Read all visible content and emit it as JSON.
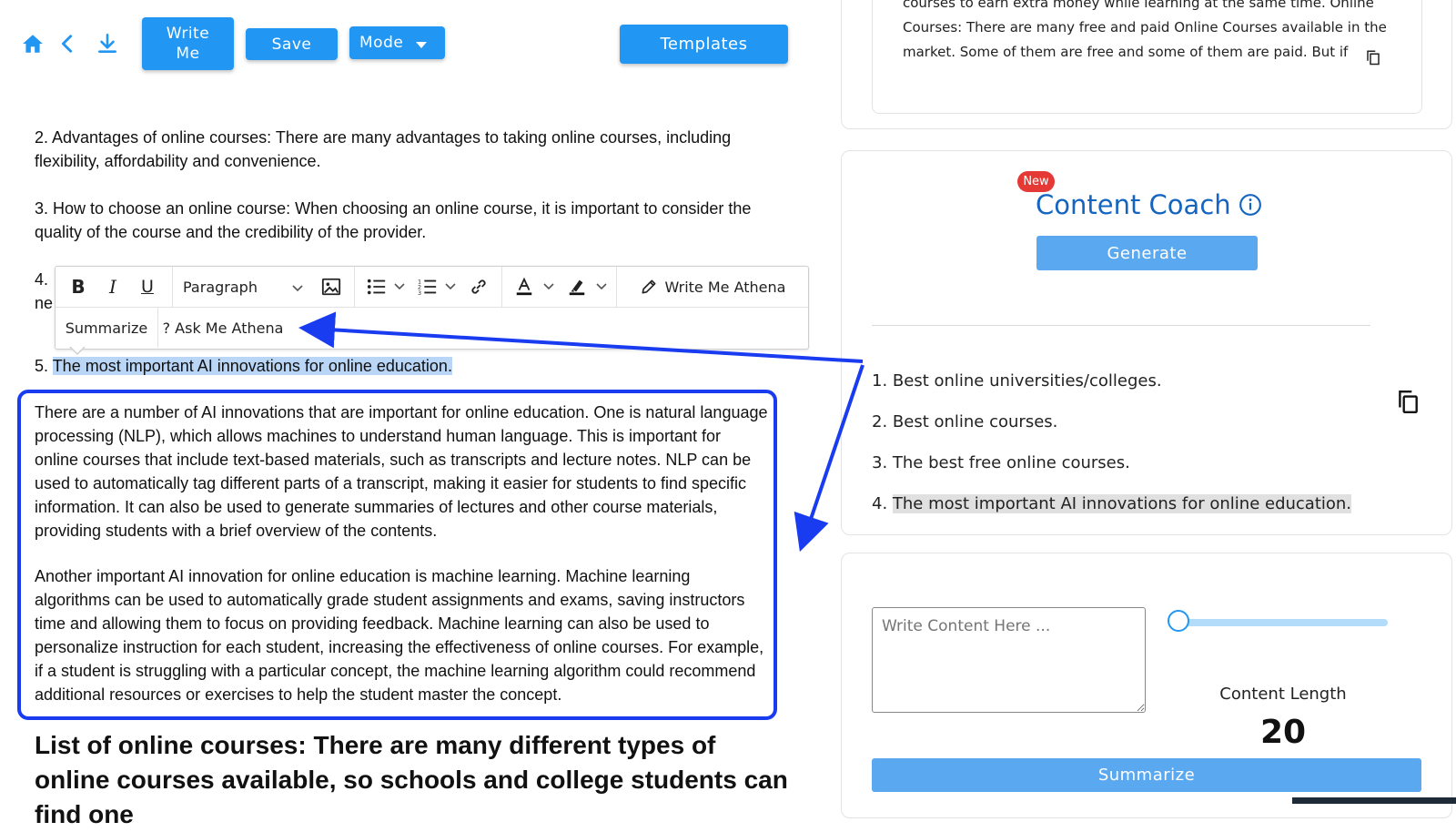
{
  "toolbar": {
    "write_me_label_line1": "Write",
    "write_me_label_line2": "Me",
    "save_label": "Save",
    "mode_label": "Mode",
    "templates_label": "Templates"
  },
  "editor": {
    "p2": "2. Advantages of online courses: There are many advantages to taking online courses, including flexibility, affordability and convenience.",
    "p3": "3. How to choose an online course: When choosing an online course, it is important to consider the quality of the course and the credibility of the provider.",
    "p4_start": "4.",
    "p4_line2_start": "ne",
    "p5_num": "5. ",
    "p5_highlight": "The most important AI innovations for online education.",
    "generated_p1": "There are a number of AI innovations that are important for online education. One is natural language processing (NLP), which allows machines to understand human language. This is important for online courses that include text-based materials, such as transcripts and lecture notes. NLP can be used to automatically tag different parts of a transcript, making it easier for students to find specific information. It can also be used to generate summaries of lectures and other course materials, providing students with a brief overview of the contents.",
    "generated_p2": "Another important AI innovation for online education is machine learning. Machine learning algorithms can be used to automatically grade student assignments and exams, saving instructors time and allowing them to focus on providing feedback. Machine learning can also be used to personalize instruction for each student, increasing the effectiveness of online courses. For example, if a student is struggling with a particular concept, the machine learning algorithm could recommend additional resources or exercises to help the student master the concept.",
    "heading": "List of online courses: There are many different types of online courses available, so schools and college students can find one"
  },
  "format_toolbar": {
    "paragraph_label": "Paragraph",
    "write_me_athena_label": "Write Me Athena",
    "summarize_label": "Summarize",
    "ask_me_athena_label": "? Ask Me Athena"
  },
  "right_panel": {
    "top_snippet_line0": "courses to earn extra money while learning at the same time. Online",
    "top_snippet_line1": "Courses: There are many free and paid Online Courses available in the",
    "top_snippet_line2": "market. Some of them are free and some of them are paid. But if",
    "new_badge": "New",
    "coach_title": "Content Coach",
    "generate_label": "Generate",
    "suggestions": [
      "1. Best online universities/colleges.",
      "2. Best online courses.",
      "3. The best free online courses."
    ],
    "suggestion4_num": "4. ",
    "suggestion4_text": "The most important AI innovations for online education.",
    "content_placeholder": "Write Content Here ...",
    "content_length_label": "Content Length",
    "content_length_value": "20",
    "summarize_label": "Summarize"
  },
  "colors": {
    "accent": "#2196f3",
    "annotation_blue": "#1a3cf0",
    "selection": "#b9d6f7",
    "badge_red": "#e53935",
    "coach_title": "#1565c0"
  }
}
